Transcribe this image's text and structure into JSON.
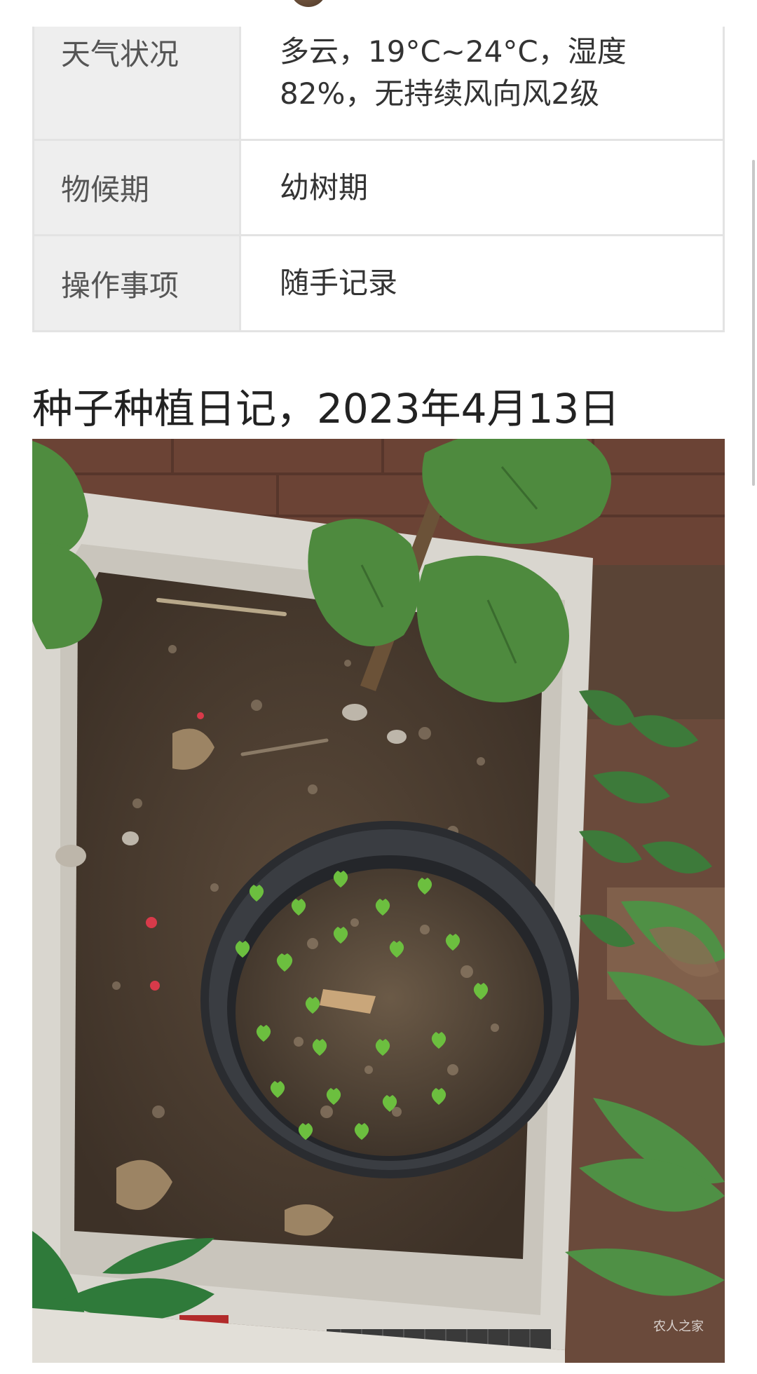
{
  "info_table": {
    "rows": [
      {
        "key": "天气状况",
        "value_line1": "多云，19°C~24°C，湿度",
        "value_line2": "82%，无持续风向风2级"
      },
      {
        "key": "物候期",
        "value": "幼树期"
      },
      {
        "key": "操作事项",
        "value": "随手记录"
      }
    ]
  },
  "article": {
    "heading": "种子种植日记，2023年4月13日"
  },
  "photo": {
    "watermark": "农人之家"
  }
}
